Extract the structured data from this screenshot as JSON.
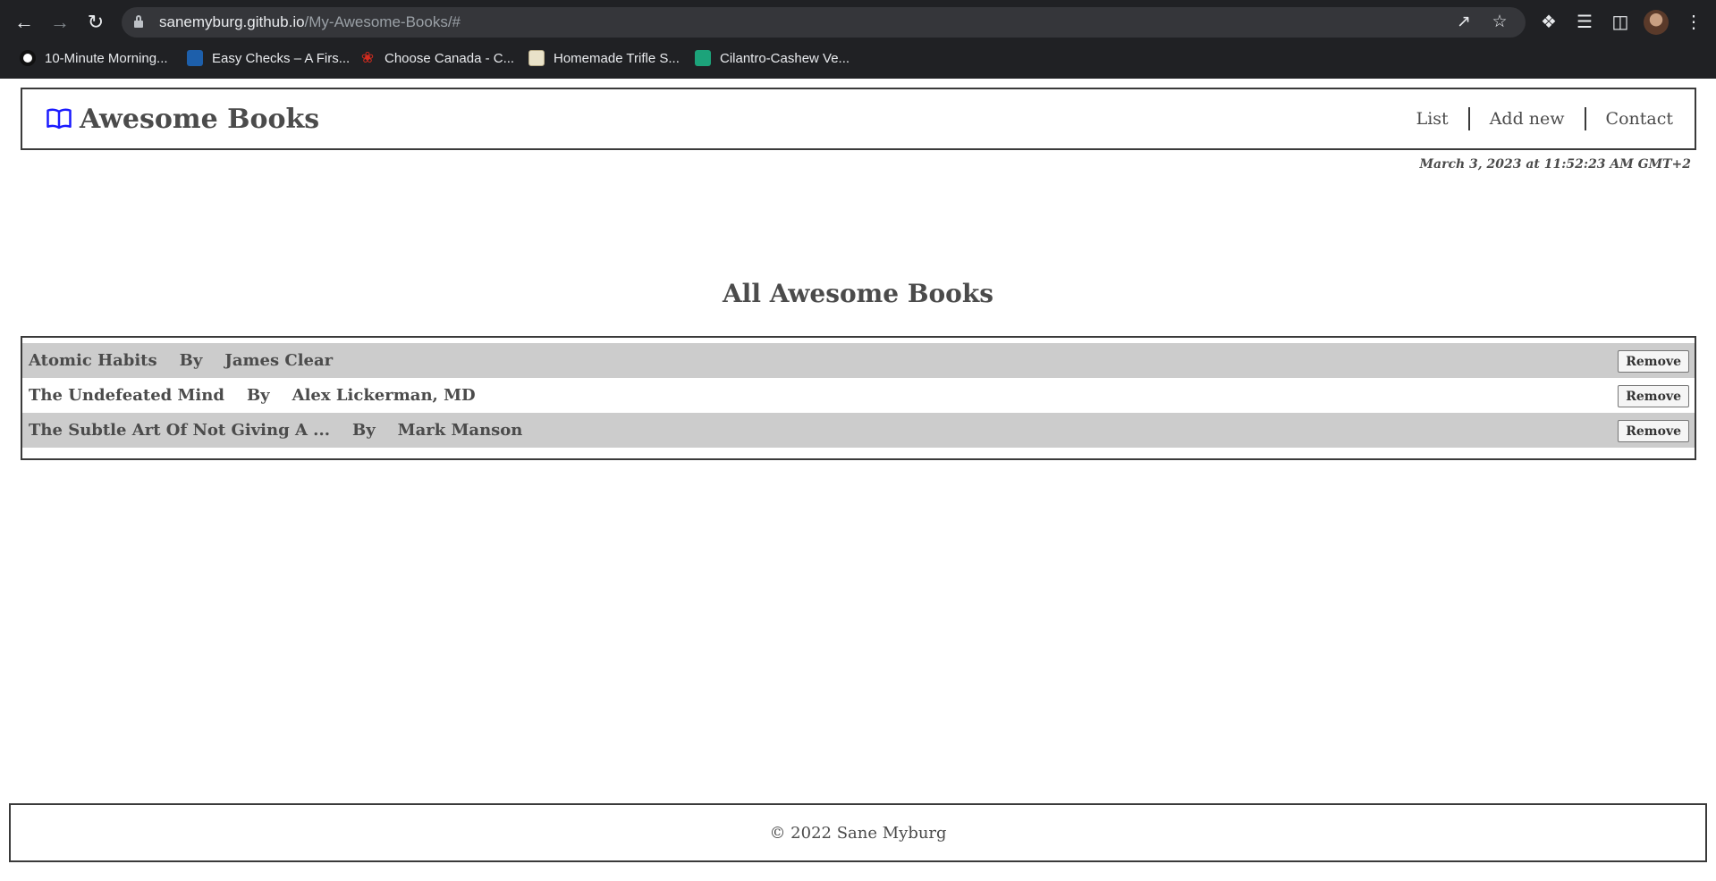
{
  "browser": {
    "url_host": "sanemyburg.github.io",
    "url_path": "/My-Awesome-Books/#",
    "icons": {
      "back": "arrow-left-icon",
      "forward": "arrow-right-icon",
      "reload": "reload-icon",
      "share": "share-icon",
      "bookmark": "star-icon",
      "extensions": "puzzle-icon",
      "media": "media-queue-icon",
      "sidepanel": "side-panel-icon",
      "menu": "kebab-menu-icon"
    },
    "bookmarks": [
      {
        "label": "10-Minute Morning...",
        "icon": "h-logo-icon"
      },
      {
        "label": "Easy Checks – A Firs...",
        "icon": "w3c-logo-icon"
      },
      {
        "label": "Choose Canada - C...",
        "icon": "maple-leaf-icon"
      },
      {
        "label": "Homemade Trifle S...",
        "icon": "recipe-favicon-icon"
      },
      {
        "label": "Cilantro-Cashew Ve...",
        "icon": "leaf-favicon-icon"
      }
    ]
  },
  "header": {
    "logo_text": "Awesome Books",
    "logo_icon": "open-book-icon",
    "logo_color": "#1a1aff",
    "nav": [
      "List",
      "Add new",
      "Contact"
    ]
  },
  "datetime": "March 3, 2023 at 11:52:23 AM GMT+2",
  "main": {
    "heading": "All Awesome Books",
    "by_label": "By",
    "remove_label": "Remove",
    "books": [
      {
        "title": "Atomic Habits",
        "author": "James Clear"
      },
      {
        "title": "The Undefeated Mind",
        "author": "Alex Lickerman, MD"
      },
      {
        "title": "The Subtle Art Of Not Giving A ...",
        "author": "Mark Manson"
      }
    ]
  },
  "footer": {
    "copyright": "© 2022 Sane Myburg"
  }
}
